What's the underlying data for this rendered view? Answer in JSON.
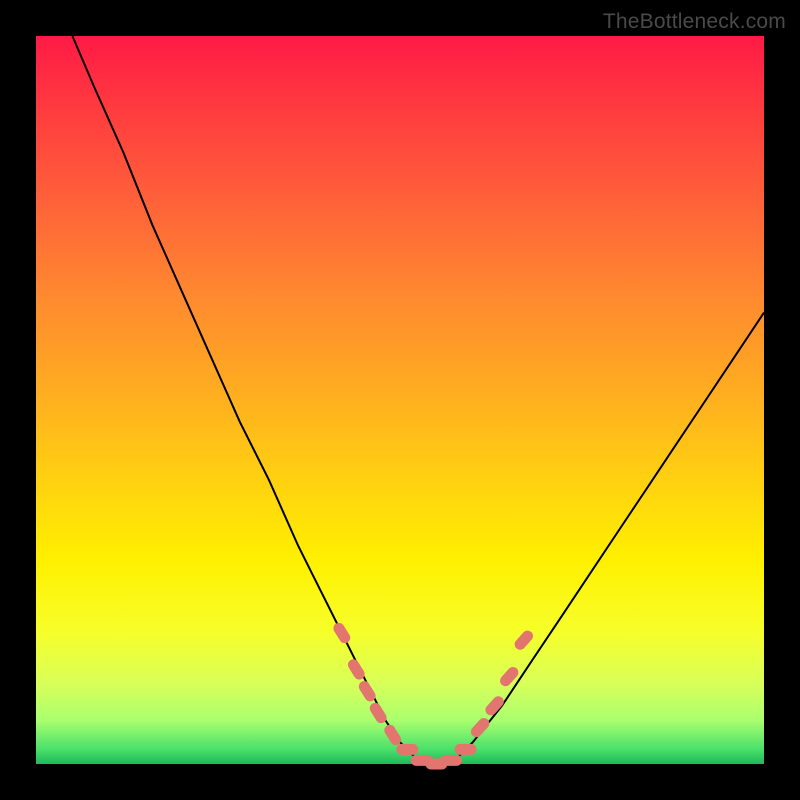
{
  "watermark": "TheBottleneck.com",
  "colors": {
    "frame_bg": "#000000",
    "marker": "#e2766e",
    "curve": "#000000",
    "gradient_stops": [
      "#ff1a46",
      "#ff3b3f",
      "#ff5f3a",
      "#ff8a2f",
      "#ffb01f",
      "#ffd40f",
      "#fff000",
      "#f6ff2b",
      "#d8ff59",
      "#aaff6e",
      "#49e06a",
      "#1fb85a"
    ]
  },
  "chart_data": {
    "type": "line",
    "title": "",
    "xlabel": "",
    "ylabel": "",
    "xlim": [
      0,
      100
    ],
    "ylim": [
      0,
      100
    ],
    "grid": false,
    "legend": null,
    "annotations": [
      "TheBottleneck.com"
    ],
    "series": [
      {
        "name": "bottleneck-curve",
        "x": [
          5,
          8,
          12,
          16,
          20,
          24,
          28,
          32,
          36,
          38,
          40,
          42,
          44,
          46,
          48,
          50,
          52,
          54,
          56,
          58,
          60,
          64,
          68,
          72,
          76,
          80,
          84,
          88,
          92,
          96,
          100
        ],
        "y": [
          100,
          93,
          84,
          74,
          65,
          56,
          47,
          39,
          30,
          26,
          22,
          18,
          14,
          10,
          6,
          3,
          1,
          0,
          0,
          1,
          3,
          8,
          14,
          20,
          26,
          32,
          38,
          44,
          50,
          56,
          62
        ]
      }
    ],
    "markers": {
      "name": "highlighted-points",
      "x": [
        42,
        44,
        45.5,
        47,
        49,
        51,
        53,
        55,
        57,
        59,
        61,
        63,
        65,
        67
      ],
      "y": [
        18,
        13,
        10,
        7,
        4,
        2,
        0.5,
        0,
        0.5,
        2,
        5,
        8,
        12,
        17
      ]
    }
  }
}
